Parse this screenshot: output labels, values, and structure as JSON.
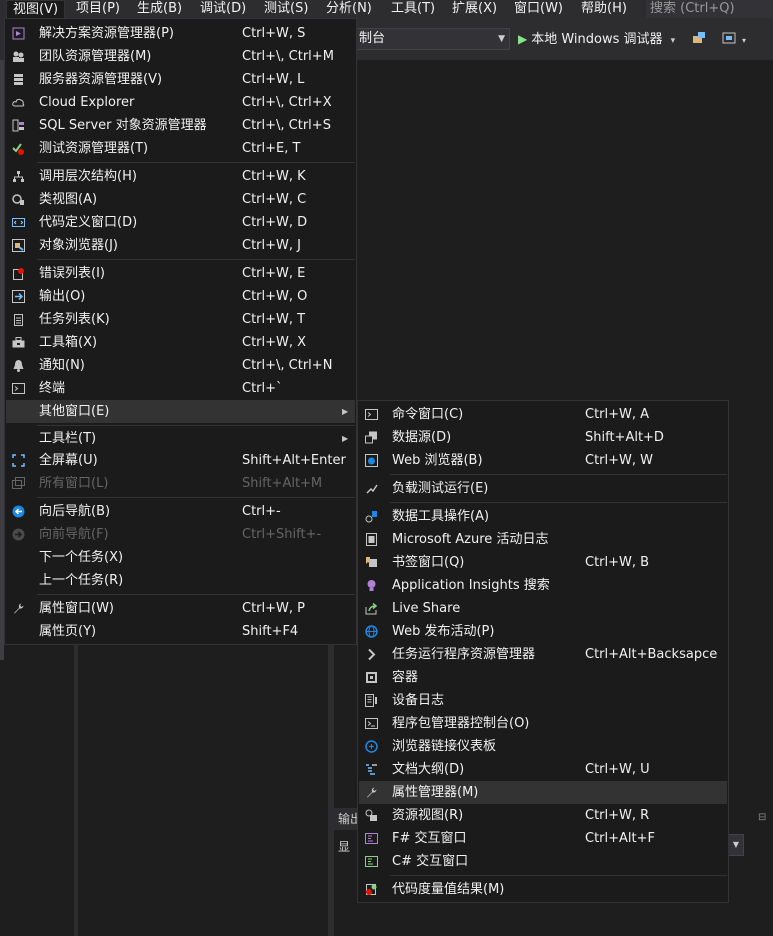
{
  "menubar": {
    "items": [
      "视图(V)",
      "项目(P)",
      "生成(B)",
      "调试(D)",
      "测试(S)",
      "分析(N)",
      "工具(T)",
      "扩展(X)",
      "窗口(W)",
      "帮助(H)"
    ],
    "search_placeholder": "搜索 (Ctrl+Q)"
  },
  "toolbar": {
    "config_text": "制台",
    "run_label": "本地 Windows 调试器"
  },
  "output_tab": {
    "label": "输出",
    "show_label": "显"
  },
  "view_menu": {
    "items": [
      {
        "label": "解决方案资源管理器(P)",
        "shortcut": "Ctrl+W, S",
        "icon": "solution-explorer-icon"
      },
      {
        "label": "团队资源管理器(M)",
        "shortcut": "Ctrl+\\, Ctrl+M",
        "icon": "team-explorer-icon"
      },
      {
        "label": "服务器资源管理器(V)",
        "shortcut": "Ctrl+W, L",
        "icon": "server-explorer-icon"
      },
      {
        "label": "Cloud Explorer",
        "shortcut": "Ctrl+\\, Ctrl+X",
        "icon": "cloud-icon"
      },
      {
        "label": "SQL Server 对象资源管理器",
        "shortcut": "Ctrl+\\, Ctrl+S",
        "icon": "sql-server-icon"
      },
      {
        "label": "测试资源管理器(T)",
        "shortcut": "Ctrl+E, T",
        "icon": "test-explorer-icon"
      },
      {
        "label": "调用层次结构(H)",
        "shortcut": "Ctrl+W, K",
        "icon": "call-hierarchy-icon"
      },
      {
        "label": "类视图(A)",
        "shortcut": "Ctrl+W, C",
        "icon": "class-view-icon"
      },
      {
        "label": "代码定义窗口(D)",
        "shortcut": "Ctrl+W, D",
        "icon": "code-definition-icon"
      },
      {
        "label": "对象浏览器(J)",
        "shortcut": "Ctrl+W, J",
        "icon": "object-browser-icon"
      },
      {
        "label": "错误列表(I)",
        "shortcut": "Ctrl+W, E",
        "icon": "error-list-icon"
      },
      {
        "label": "输出(O)",
        "shortcut": "Ctrl+W, O",
        "icon": "output-icon"
      },
      {
        "label": "任务列表(K)",
        "shortcut": "Ctrl+W, T",
        "icon": "task-list-icon"
      },
      {
        "label": "工具箱(X)",
        "shortcut": "Ctrl+W, X",
        "icon": "toolbox-icon"
      },
      {
        "label": "通知(N)",
        "shortcut": "Ctrl+\\, Ctrl+N",
        "icon": "bell-icon"
      },
      {
        "label": "终端",
        "shortcut": "Ctrl+`",
        "icon": "terminal-icon"
      },
      {
        "label": "其他窗口(E)",
        "shortcut": "",
        "icon": ""
      },
      {
        "label": "工具栏(T)",
        "shortcut": "",
        "icon": ""
      },
      {
        "label": "全屏幕(U)",
        "shortcut": "Shift+Alt+Enter",
        "icon": "fullscreen-icon"
      },
      {
        "label": "所有窗口(L)",
        "shortcut": "Shift+Alt+M",
        "icon": "all-windows-icon"
      },
      {
        "label": "向后导航(B)",
        "shortcut": "Ctrl+-",
        "icon": "navigate-back-icon"
      },
      {
        "label": "向前导航(F)",
        "shortcut": "Ctrl+Shift+-",
        "icon": "navigate-forward-icon"
      },
      {
        "label": "下一个任务(X)",
        "shortcut": "",
        "icon": ""
      },
      {
        "label": "上一个任务(R)",
        "shortcut": "",
        "icon": ""
      },
      {
        "label": "属性窗口(W)",
        "shortcut": "Ctrl+W, P",
        "icon": "wrench-icon"
      },
      {
        "label": "属性页(Y)",
        "shortcut": "Shift+F4",
        "icon": ""
      }
    ]
  },
  "other_windows_menu": {
    "items": [
      {
        "label": "命令窗口(C)",
        "shortcut": "Ctrl+W, A",
        "icon": "command-window-icon"
      },
      {
        "label": "数据源(D)",
        "shortcut": "Shift+Alt+D",
        "icon": "data-sources-icon"
      },
      {
        "label": "Web 浏览器(B)",
        "shortcut": "Ctrl+W, W",
        "icon": "web-browser-icon"
      },
      {
        "label": "负载测试运行(E)",
        "shortcut": "",
        "icon": "load-test-icon"
      },
      {
        "label": "数据工具操作(A)",
        "shortcut": "",
        "icon": "data-tools-icon"
      },
      {
        "label": "Microsoft Azure 活动日志",
        "shortcut": "",
        "icon": "azure-log-icon"
      },
      {
        "label": "书签窗口(Q)",
        "shortcut": "Ctrl+W, B",
        "icon": "bookmark-icon"
      },
      {
        "label": "Application Insights 搜索",
        "shortcut": "",
        "icon": "lightbulb-icon"
      },
      {
        "label": "Live Share",
        "shortcut": "",
        "icon": "live-share-icon"
      },
      {
        "label": "Web 发布活动(P)",
        "shortcut": "",
        "icon": "globe-icon"
      },
      {
        "label": "任务运行程序资源管理器",
        "shortcut": "Ctrl+Alt+Backsapce",
        "icon": "chevron-right-icon"
      },
      {
        "label": "容器",
        "shortcut": "",
        "icon": "container-icon"
      },
      {
        "label": "设备日志",
        "shortcut": "",
        "icon": "device-log-icon"
      },
      {
        "label": "程序包管理器控制台(O)",
        "shortcut": "",
        "icon": "package-console-icon"
      },
      {
        "label": "浏览器链接仪表板",
        "shortcut": "",
        "icon": "browser-link-icon"
      },
      {
        "label": "文档大纲(D)",
        "shortcut": "Ctrl+W, U",
        "icon": "document-outline-icon"
      },
      {
        "label": "属性管理器(M)",
        "shortcut": "",
        "icon": "wrench-icon"
      },
      {
        "label": "资源视图(R)",
        "shortcut": "Ctrl+W, R",
        "icon": "resource-view-icon"
      },
      {
        "label": "F# 交互窗口",
        "shortcut": "Ctrl+Alt+F",
        "icon": "fsharp-interactive-icon"
      },
      {
        "label": "C# 交互窗口",
        "shortcut": "",
        "icon": "csharp-interactive-icon"
      },
      {
        "label": "代码度量值结果(M)",
        "shortcut": "",
        "icon": "code-metrics-icon"
      }
    ]
  }
}
